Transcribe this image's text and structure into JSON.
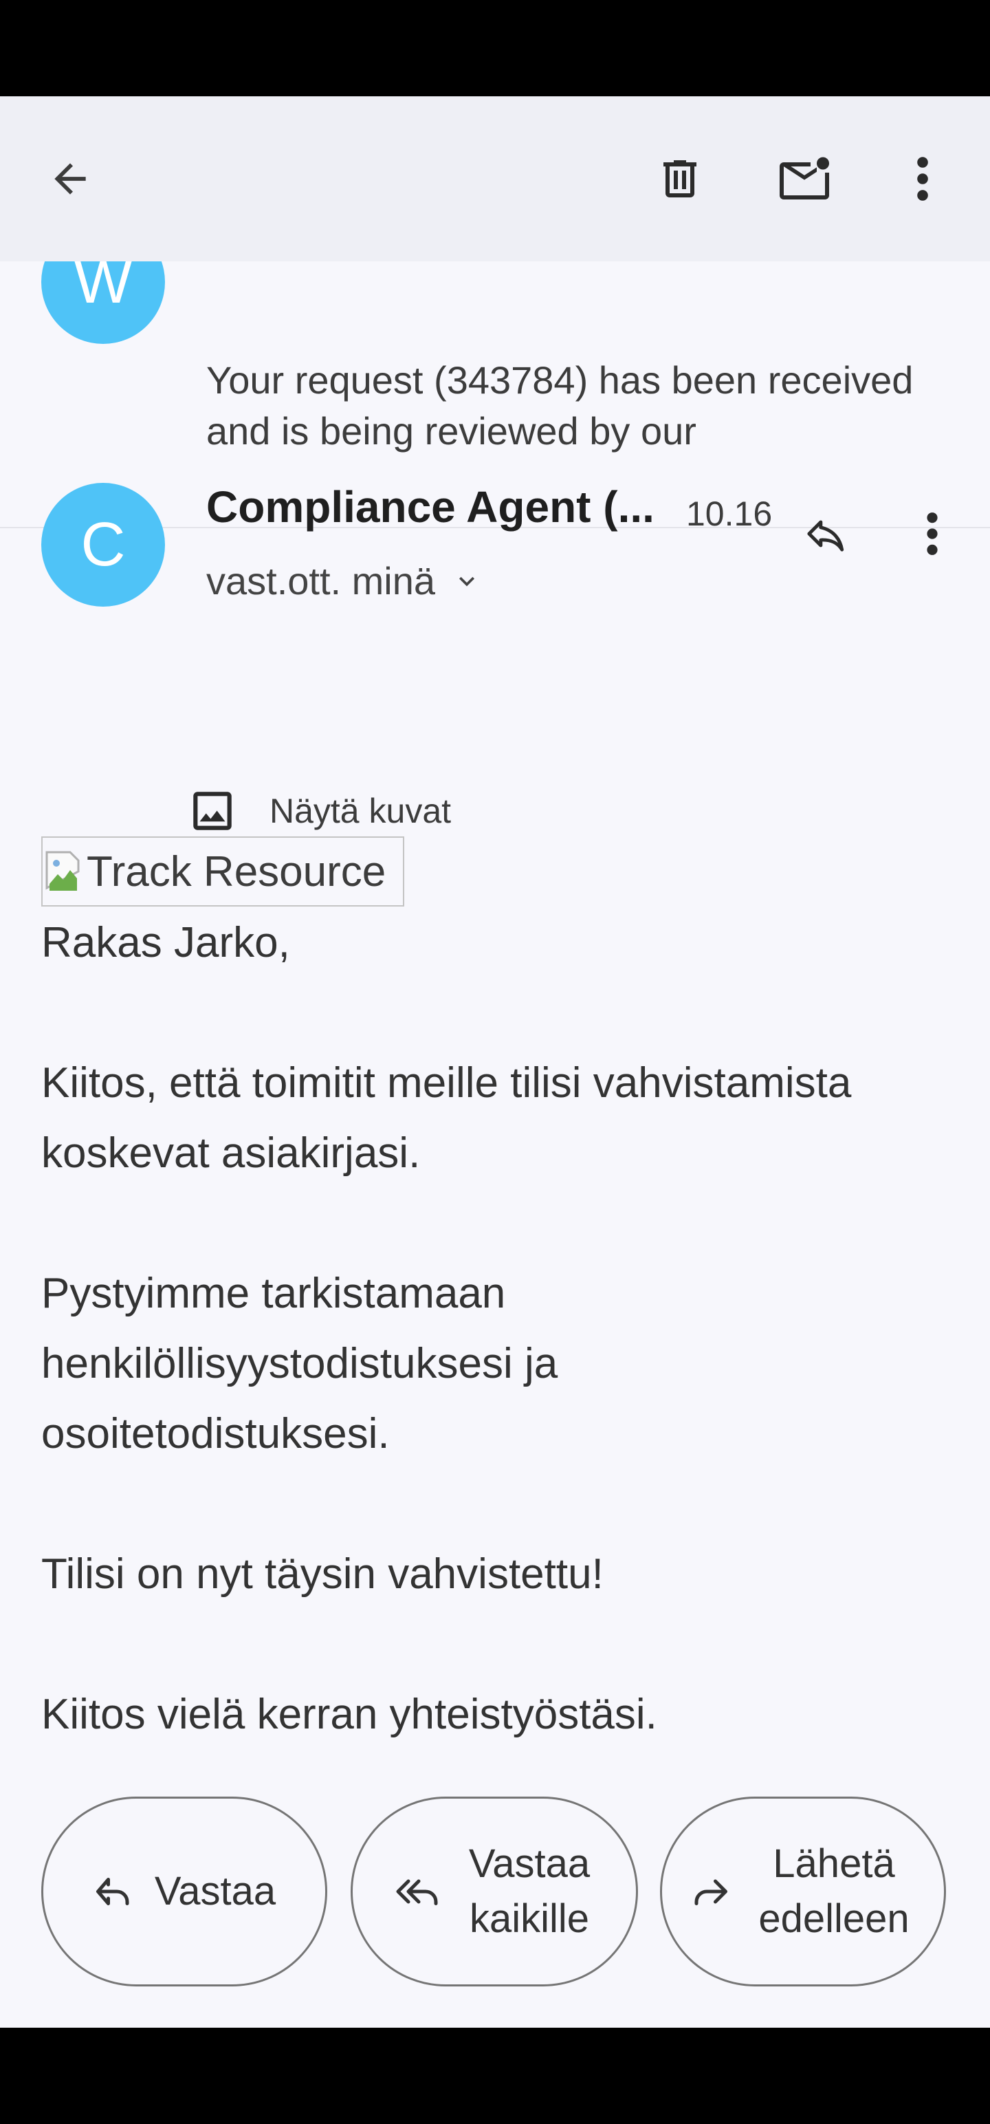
{
  "appbar": {
    "back_icon": "arrow-back-icon",
    "delete_icon": "trash-icon",
    "mark_unread_icon": "mail-unread-icon",
    "more_icon": "more-vert-icon"
  },
  "previous_message": {
    "avatar_letter": "W",
    "snippet": "Your request (343784) has been received and is being reviewed by our"
  },
  "message": {
    "avatar_letter": "C",
    "sender": "Compliance Agent (...",
    "time": "10.16",
    "recipients": "vast.ott. minä",
    "show_images": "Näytä kuvat",
    "image_alt": "Track Resource",
    "greeting": "Rakas Jarko,",
    "paragraphs": [
      "Kiitos, että toimitit meille tilisi vahvistamista koskevat asiakirjasi.",
      "Pystyimme tarkistamaan henkilöllisyystodistuksesi ja osoitetodistuksesi.",
      "Tilisi on nyt täysin vahvistettu!",
      "Kiitos vielä kerran yhteistyöstäsi."
    ]
  },
  "actions": {
    "reply": "Vastaa",
    "reply_all": "Vastaa kaikille",
    "forward": "Lähetä edelleen"
  },
  "colors": {
    "avatar": "#4fc3f7",
    "appbar": "#eeeff5",
    "background": "#f7f7fc"
  }
}
